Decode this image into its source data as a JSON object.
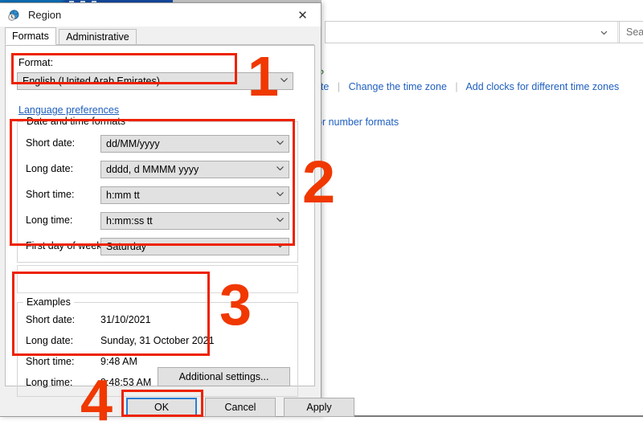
{
  "background_window": {
    "address_bar": {
      "dropdown_icon": "chevron-down-icon",
      "refresh_icon": "refresh-icon"
    },
    "search_box": {
      "text": "Sea"
    },
    "green_fragment": "?",
    "links_row1": [
      {
        "label": "ate"
      },
      {
        "label": "Change the time zone"
      },
      {
        "label": "Add clocks for different time zones"
      }
    ],
    "links_row2": [
      {
        "label": "or number formats"
      }
    ]
  },
  "dialog": {
    "icon": "region-globe-icon",
    "title": "Region",
    "close_label": "✕",
    "tabs": [
      {
        "label": "Formats",
        "active": true
      },
      {
        "label": "Administrative",
        "active": false
      }
    ],
    "format": {
      "label": "Format:",
      "value": "English (United Arab Emirates)",
      "arrow": "⌄"
    },
    "language_preferences_link": "Language preferences",
    "date_time_group": {
      "title": "Date and time formats",
      "rows": [
        {
          "label": "Short date:",
          "value": "dd/MM/yyyy"
        },
        {
          "label": "Long date:",
          "value": "dddd, d MMMM yyyy"
        },
        {
          "label": "Short time:",
          "value": "h:mm tt"
        },
        {
          "label": "Long time:",
          "value": "h:mm:ss tt"
        },
        {
          "label": "First day of week:",
          "value": "Saturday"
        }
      ]
    },
    "examples_group": {
      "title": "Examples",
      "rows": [
        {
          "label": "Short date:",
          "value": "31/10/2021"
        },
        {
          "label": "Long date:",
          "value": "Sunday, 31 October 2021"
        },
        {
          "label": "Short time:",
          "value": "9:48 AM"
        },
        {
          "label": "Long time:",
          "value": "9:48:53 AM"
        }
      ]
    },
    "additional_settings_label": "Additional settings...",
    "buttons": {
      "ok": "OK",
      "cancel": "Cancel",
      "apply": "Apply"
    }
  },
  "annotations": {
    "color": "#f03800",
    "steps": [
      {
        "number": "1"
      },
      {
        "number": "2"
      },
      {
        "number": "3"
      },
      {
        "number": "4"
      }
    ]
  }
}
